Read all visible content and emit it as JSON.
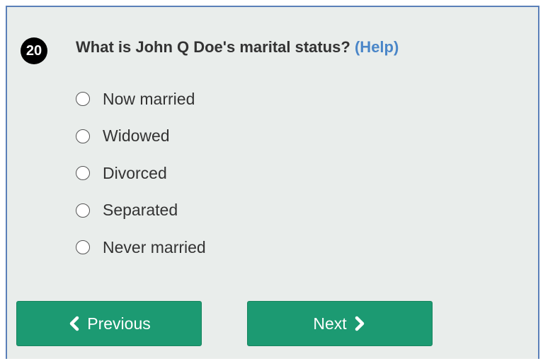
{
  "question": {
    "number": "20",
    "text": "What is John Q Doe's marital status?",
    "help_label": "(Help)"
  },
  "options": [
    {
      "label": "Now married",
      "selected": false
    },
    {
      "label": "Widowed",
      "selected": false
    },
    {
      "label": "Divorced",
      "selected": false
    },
    {
      "label": "Separated",
      "selected": false
    },
    {
      "label": "Never married",
      "selected": false
    }
  ],
  "navigation": {
    "previous_label": "Previous",
    "previous_icon": "chevron-left-icon",
    "next_label": "Next",
    "next_icon": "chevron-right-icon"
  },
  "colors": {
    "panel_background": "#e9edeb",
    "panel_border": "#5a7fb8",
    "button": "#1c9a72",
    "help_link": "#4a86c8",
    "number_badge": "#000000"
  }
}
